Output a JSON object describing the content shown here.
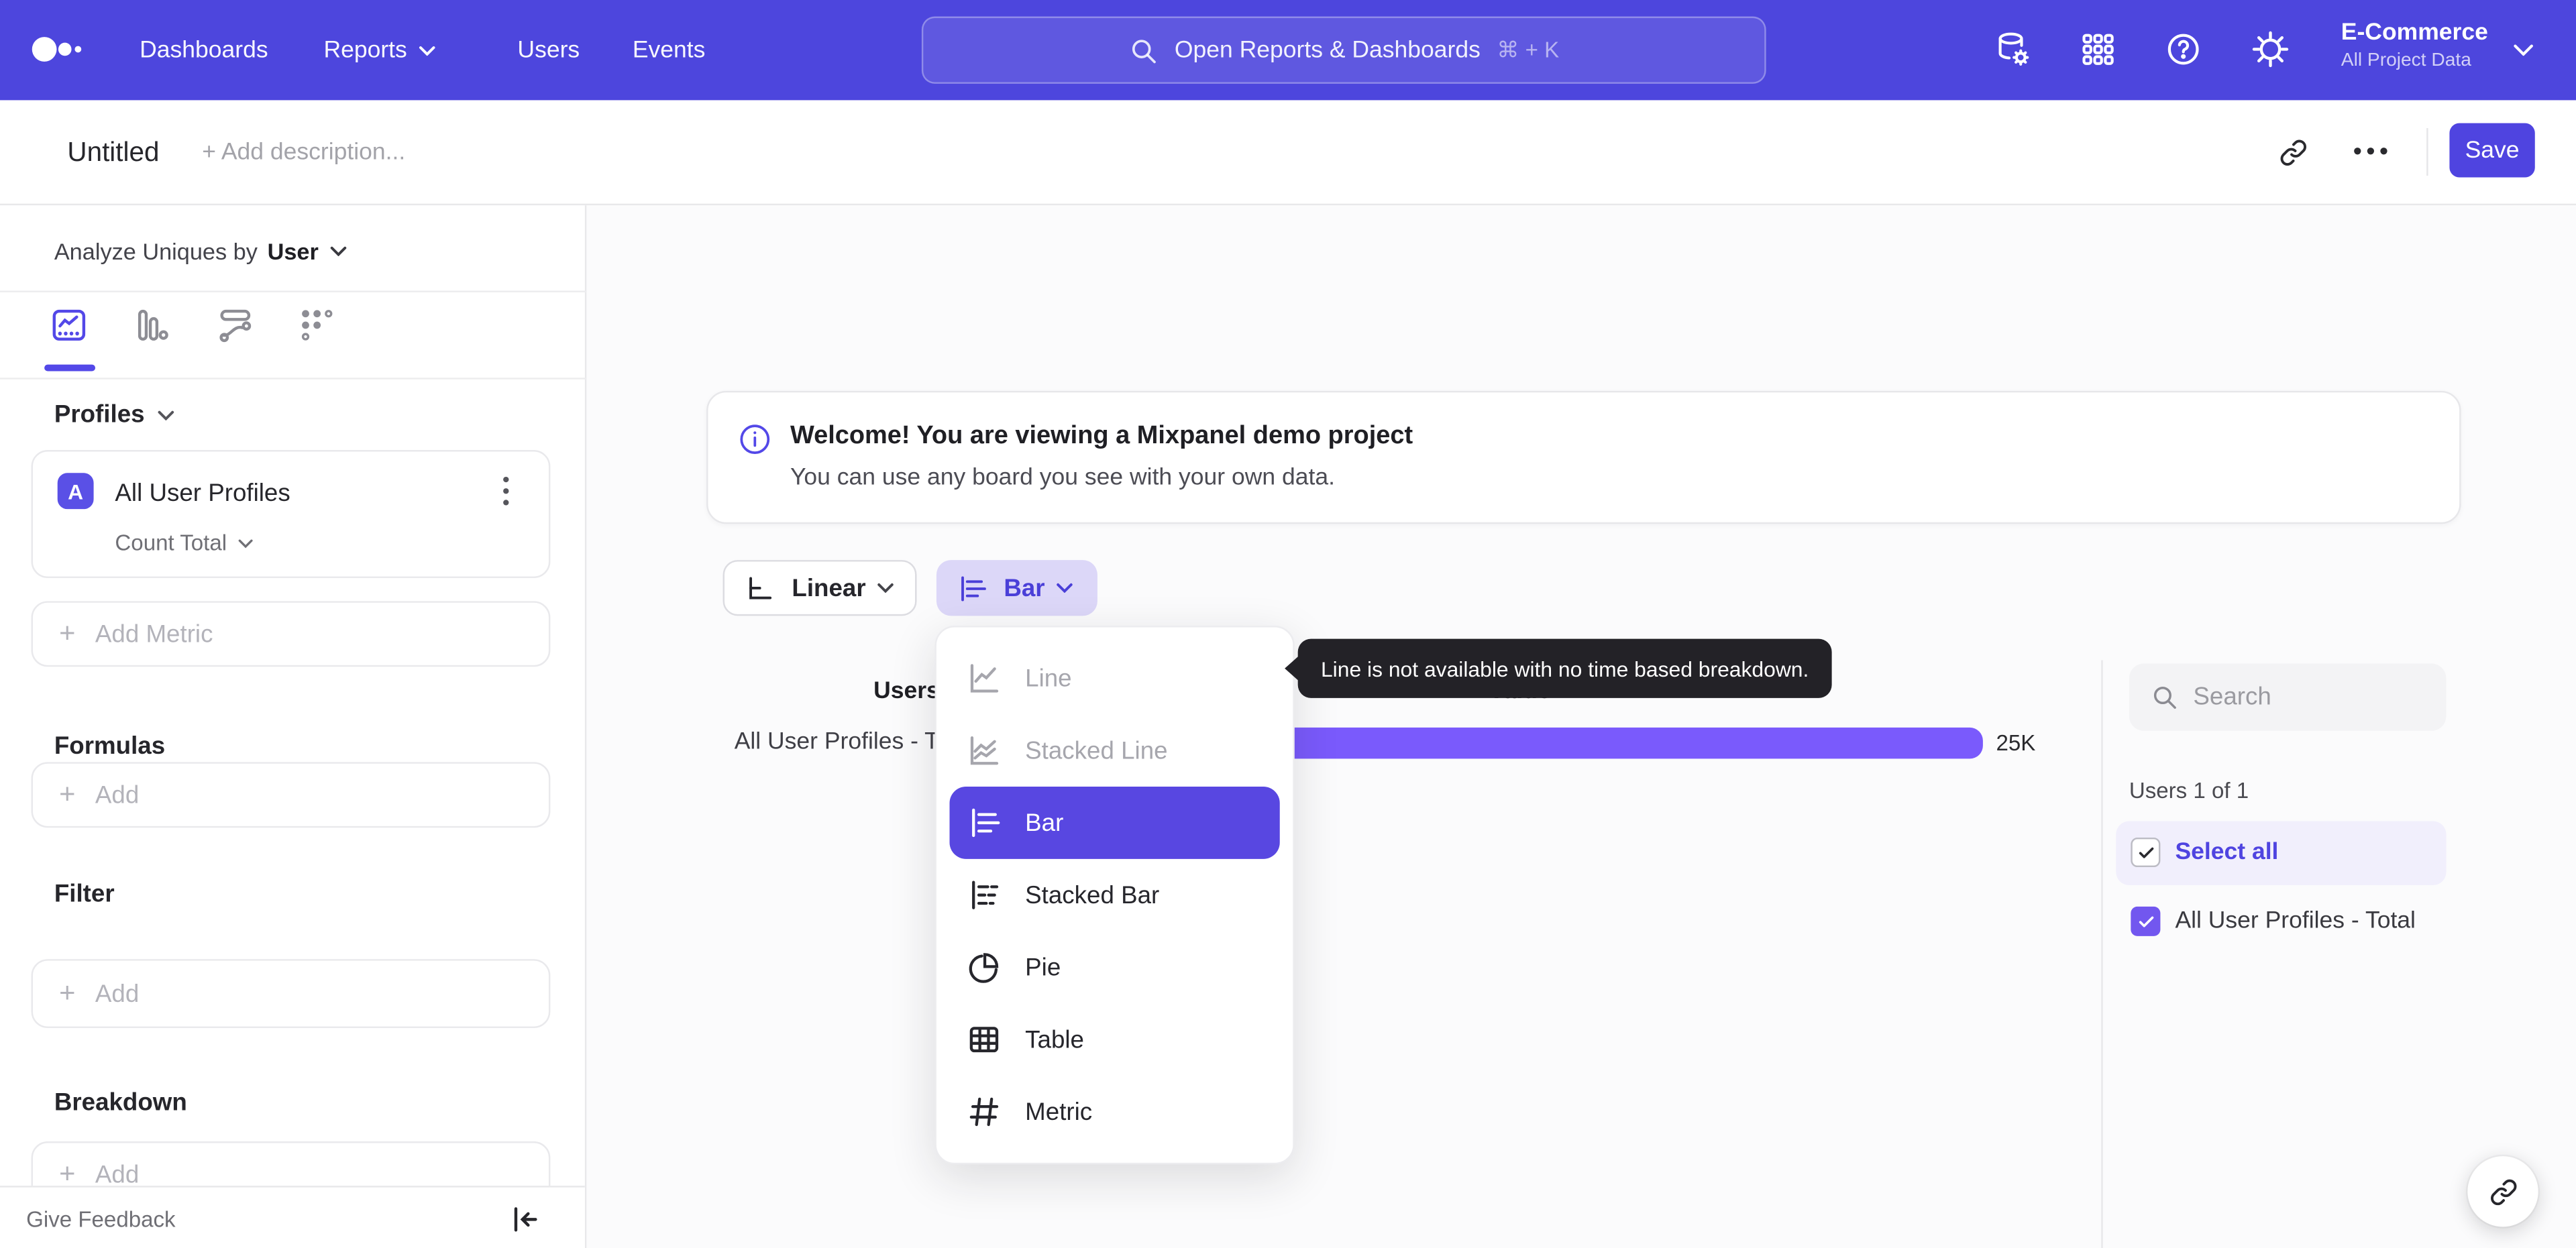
{
  "topnav": {
    "items": [
      {
        "label": "Dashboards"
      },
      {
        "label": "Reports"
      },
      {
        "label": "Users"
      },
      {
        "label": "Events"
      }
    ],
    "search_placeholder": "Open Reports & Dashboards",
    "search_shortcut": "⌘ + K",
    "project_name": "E-Commerce",
    "project_scope": "All Project Data"
  },
  "toolbar": {
    "title": "Untitled",
    "description_placeholder": "+ Add description...",
    "save_label": "Save"
  },
  "sidebar": {
    "analyze_label": "Analyze Uniques by",
    "analyze_value": "User",
    "profiles_label": "Profiles",
    "metric": {
      "letter": "A",
      "name": "All User Profiles",
      "aggregation": "Count Total"
    },
    "add_metric_label": "Add Metric",
    "formulas_label": "Formulas",
    "filter_label": "Filter",
    "breakdown_label": "Breakdown",
    "add_label": "Add",
    "feedback_label": "Give Feedback"
  },
  "main": {
    "banner": {
      "title": "Welcome! You are viewing a Mixpanel demo project",
      "subtitle": "You can use any board you see with your own data."
    },
    "scale_button": "Linear",
    "chart_type_button": "Bar",
    "menu_items": [
      {
        "label": "Line",
        "state": "disabled"
      },
      {
        "label": "Stacked Line",
        "state": "disabled"
      },
      {
        "label": "Bar",
        "state": "selected"
      },
      {
        "label": "Stacked Bar",
        "state": "normal"
      },
      {
        "label": "Pie",
        "state": "normal"
      },
      {
        "label": "Table",
        "state": "normal"
      },
      {
        "label": "Metric",
        "state": "normal"
      }
    ],
    "tooltip": "Line is not available with no time based breakdown.",
    "chart": {
      "col_users": "Users",
      "col_value": "Value",
      "row_label": "All User Profiles - Total",
      "value_label": "25K"
    }
  },
  "right_panel": {
    "search_placeholder": "Search",
    "count_label": "Users 1 of 1",
    "select_all": "Select all",
    "row_label": "All User Profiles - Total"
  },
  "chart_data": {
    "type": "bar",
    "orientation": "horizontal",
    "columns": [
      "Users",
      "Value"
    ],
    "categories": [
      "All User Profiles - Total"
    ],
    "values": [
      25000
    ],
    "value_labels": [
      "25K"
    ]
  },
  "colors": {
    "nav": "#4D46DD",
    "accent": "#4F44E0",
    "bar": "#7A5AFC",
    "menu_selected": "#5847E1",
    "checkbox": "#7257EF",
    "tooltip_bg": "#232227"
  }
}
